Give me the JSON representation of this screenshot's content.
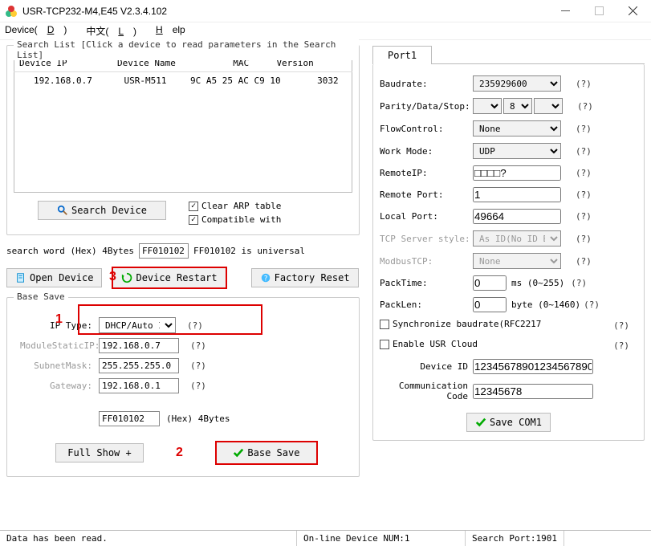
{
  "window": {
    "title": "USR-TCP232-M4,E45 V2.3.4.102"
  },
  "menu": {
    "device": "Device(",
    "device_u": "D",
    "device_end": ")",
    "cn": "中文(",
    "cn_u": "L",
    "cn_end": ")",
    "help_u": "H",
    "help": "elp"
  },
  "searchlist": {
    "title": "Search List [Click a device to read parameters in the Search List]",
    "headers": [
      "Device IP",
      "Device Name",
      "MAC",
      "Version"
    ],
    "rows": [
      [
        "192.168.0.7",
        "USR-M511",
        "9C A5 25 AC C9 10",
        "3032"
      ]
    ]
  },
  "buttons": {
    "search": "Search Device",
    "open": "Open Device",
    "restart": "Device Restart",
    "factory": "Factory Reset",
    "fullshow": "Full Show  +",
    "basesave": "Base Save",
    "savecom1": "Save COM1"
  },
  "checks": {
    "clear_arp": "Clear ARP table",
    "compat": "Compatible with"
  },
  "searchword": {
    "label": "search word (Hex) 4Bytes",
    "value": "FF010102",
    "note": "FF010102 is universal"
  },
  "bs": {
    "title": "Base Save",
    "ip_type_lbl": "IP    Type:",
    "ip_type_val": "DHCP/Auto IP",
    "static_lbl": "ModuleStaticIP:",
    "static_val": "192.168.0.7",
    "subnet_lbl": "SubnetMask:",
    "subnet_val": "255.255.255.0",
    "gateway_lbl": "Gateway:",
    "gateway_val": "192.168.0.1",
    "hex_val": "FF010102",
    "hex_note": "(Hex) 4Bytes"
  },
  "port": {
    "tab": "Port1",
    "baud_lbl": "Baudrate:",
    "baud_val": "235929600",
    "pds_lbl": "Parity/Data/Stop:",
    "pds_b": "8",
    "flow_lbl": "FlowControl:",
    "flow_val": "None",
    "mode_lbl": "Work Mode:",
    "mode_val": "UDP",
    "rip_lbl": "RemoteIP:",
    "rip_val": "□□□□?",
    "rport_lbl": "Remote Port:",
    "rport_val": "1",
    "lport_lbl": "Local Port:",
    "lport_val": "49664",
    "tss_lbl": "TCP Server style:",
    "tss_val": "As ID(No ID Broadca",
    "mtcp_lbl": "ModbusTCP:",
    "mtcp_val": "None",
    "ptime_lbl": "PackTime:",
    "ptime_val": "0",
    "ptime_unit": "ms (0~255)",
    "plen_lbl": "PackLen:",
    "plen_val": "0",
    "plen_unit": "byte (0~1460)",
    "sync_lbl": "Synchronize baudrate(RFC2217",
    "cloud_lbl": "Enable USR Cloud",
    "devid_lbl": "Device ID",
    "devid_val": "12345678901234567890",
    "comm_lbl": "Communication Code",
    "comm_val": "12345678"
  },
  "status": {
    "a": "Data has been read.",
    "b": "On-line Device NUM:1",
    "c": "Search Port:1901"
  },
  "callouts": {
    "c1": "1",
    "c2": "2",
    "c3": "3"
  },
  "q": "(?)"
}
